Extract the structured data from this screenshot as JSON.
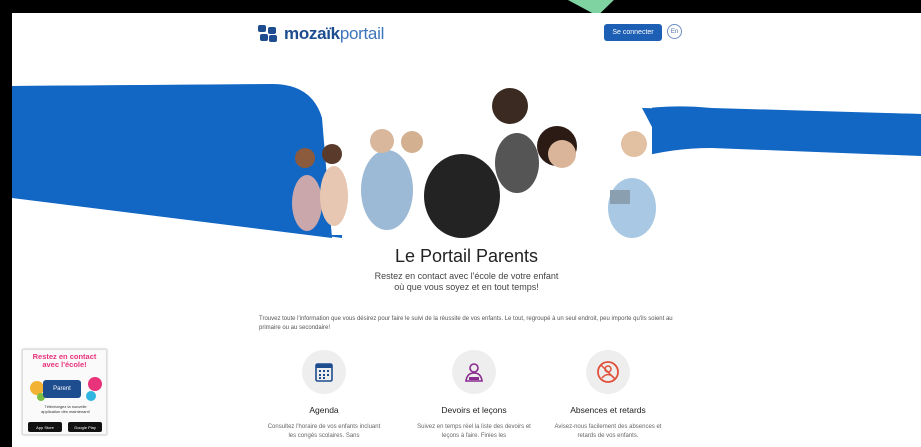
{
  "header": {
    "logo_bold": "mozaïk",
    "logo_light": "portail",
    "login_label": "Se connecter",
    "lang_label": "En"
  },
  "hero": {
    "title": "Le Portail Parents",
    "subtitle_line1": "Restez en contact avec l'école de votre enfant",
    "subtitle_line2": "où que vous soyez et en tout temps!"
  },
  "intro": "Trouvez toute l'information que vous désirez pour faire le suivi de la réussite de vos enfants. Le tout, regroupé à un seul endroit, peu importe qu'ils soient au primaire ou au secondaire!",
  "features": [
    {
      "icon": "calendar-icon",
      "title": "Agenda",
      "desc": "Consultez l'horaire de vos enfants incluant les congés scolaires. Sans"
    },
    {
      "icon": "student-icon",
      "title": "Devoirs et leçons",
      "desc": "Suivez en temps réel la liste des devoirs et leçons à faire. Finies les"
    },
    {
      "icon": "absence-icon",
      "title": "Absences et retards",
      "desc": "Avisez-nous facilement des absences et retards de vos enfants."
    }
  ],
  "promo": {
    "headline_line1": "Restez en contact",
    "headline_line2": "avec l'école!",
    "app_label": "Parent",
    "download_line1": "Téléchargez la nouvelle",
    "download_line2": "application dès maintenant!",
    "appstore_label": "App Store",
    "googleplay_label": "Google Play"
  },
  "colors": {
    "brand_blue": "#1d4d8f",
    "banner_blue": "#1266c4",
    "accent_red": "#e0503a",
    "accent_purple": "#8a2b8f"
  }
}
